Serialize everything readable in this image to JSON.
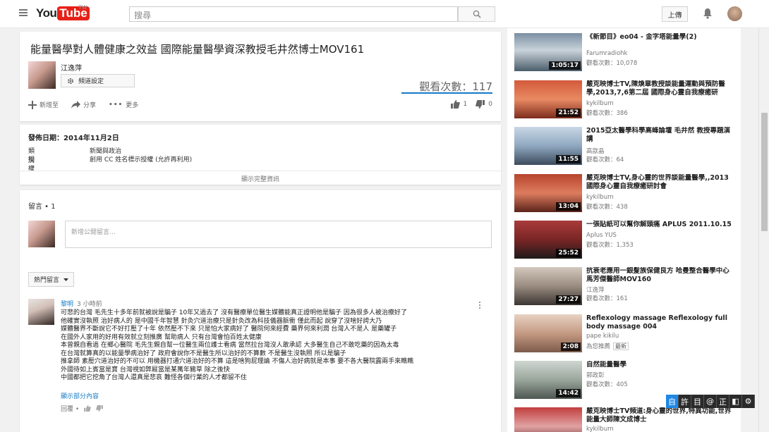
{
  "header": {
    "logo_you": "You",
    "logo_tube": "Tube",
    "logo_region": "TW",
    "search_placeholder": "搜尋",
    "upload_label": "上傳"
  },
  "video": {
    "title": "能量醫學對人體健康之效益 國際能量醫學資深教授毛井然博士MOV161",
    "owner": "江逸萍",
    "channel_settings": "頻道設定",
    "views": "觀看次數：117",
    "add_to": "新增至",
    "share": "分享",
    "more": "更多",
    "likes": "1",
    "dislikes": "0"
  },
  "description": {
    "published": "發佈日期：2014年11月2日",
    "category_label": "類別",
    "category_value": "新聞與政治",
    "license_label": "授權",
    "license_value": "創用 CC 姓名標示授權 (允許再利用)",
    "show_more": "顯示完整資訊"
  },
  "comments": {
    "count_label": "留言 • 1",
    "input_placeholder": "新增公開留言…",
    "sort_label": "熱門留言",
    "comment": {
      "author": "黎明",
      "time": "3 小時前",
      "lines": [
        "可悲的台灣 毛先生十多年前就被說是騙子 10年又過去了 沒有醫療單位醫生媒體能真正證明他是騙子 因為很多人被治療好了",
        "他確實沒執照 治好病人的 是中國千年智慧 針灸穴道治療只是針灸改為科技儀器脈衝 僅此而起 說穿了沒啥好誇大乃",
        "媒體醫界不斷說它不好打壓了十年 依然壓不下來 只是怕大家病好了 醫院何來經費 藥界何來利潤  台灣人不是人 是藥罐子",
        "在國外人家用的好用有效就立刻推廣 幫助病人 只有台灣會怕百姓太健康",
        "本曾親自看過 在鄉心醫院 毛先生親自幫一位醫生兩位護士看病 當然拉台灣沒人敢承認 大多醫生自己不敢吃藥的因為太毒",
        "在台灣就算真的以能量學病治好了 政府會說你不是醫生所以治好的不算數 不是醫生沒執照 所以是騙子",
        "推拿師 素壓穴道治好的不可以 用機器打通穴道治好的不算 這是啥狗屁理論 不傷人治好病就是本事  要不各大醫院露兩手來瞧瞧",
        "外國待如上賓當是寶 台灣視如弊屣當是某萬年豬草 除之後快",
        "中國都把它挖角了台灣人還真是悲哀 難怪各個行業的人才都留不住"
      ],
      "show_part": "顯示部分內容",
      "reply": "回覆 •"
    }
  },
  "sidebar": {
    "items": [
      {
        "title": "《新節目》eo04 - 金字塔能量學(2)",
        "channel": "Farumradiohk",
        "views": "觀看次數：10,078",
        "duration": "1:05:17"
      },
      {
        "title": "嚴克映博士TV,陳煥章教授談能量運動與預防醫學,2013,7,6第二屆 國際身心靈自我療癒研",
        "channel": "kykilburn",
        "views": "觀看次數：386",
        "duration": "21:52"
      },
      {
        "title": "2015亞太醫學科學高峰論壇 毛井然 教授專題演講",
        "channel": "高歆晶",
        "views": "觀看次數：64",
        "duration": "11:55"
      },
      {
        "title": "嚴克映博士TV,身心靈的世界談能量醫學,,2013國際身心靈自我療癒研討會",
        "channel": "kykilburn",
        "views": "觀看次數：438",
        "duration": "13:04"
      },
      {
        "title": "一張貼紙可以幫你解頭痛 APLUS 2011.10.15",
        "channel": "Aplus YUS",
        "views": "觀看次數：1,353",
        "duration": "25:52"
      },
      {
        "title": "抗衰老應用一銀髮族保健良方 哈曼整合醫學中心 馬芳傑醫師MOV160",
        "channel": "江逸萍",
        "views": "觀看次數：161",
        "duration": "27:27"
      },
      {
        "title": "Reflexology massage Reflexology full body massage 004",
        "channel": "pape kikilu",
        "views": "為您推薦",
        "badge": "最新",
        "duration": "2:08"
      },
      {
        "title": "自然能量醫學",
        "channel": "郭政彰",
        "views": "觀看次數：405",
        "duration": "14:42"
      },
      {
        "title": "嚴克映博士TV頻道:身心靈的世界,特異功能,世界能量大師陳文成博士",
        "channel": "kykilburn",
        "views": "",
        "duration": ""
      }
    ]
  },
  "ime": {
    "keys": [
      "自",
      "許",
      "目",
      "@",
      "正",
      "◧",
      "⚙"
    ]
  }
}
